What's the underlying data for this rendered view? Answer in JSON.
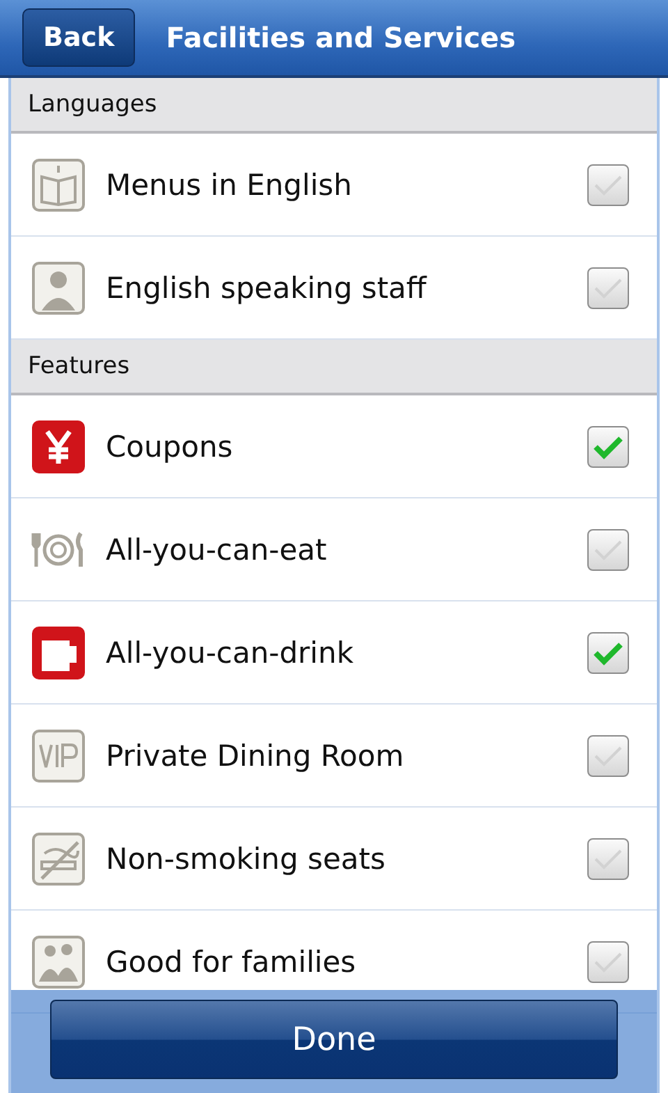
{
  "header": {
    "back_button": "Back",
    "title": "Facilities and Services"
  },
  "sections": [
    {
      "title": "Languages",
      "items": [
        {
          "label": "Menus in English",
          "checked": false
        },
        {
          "label": "English speaking staff",
          "checked": false
        }
      ]
    },
    {
      "title": "Features",
      "items": [
        {
          "label": "Coupons",
          "checked": true
        },
        {
          "label": "All-you-can-eat",
          "checked": false
        },
        {
          "label": "All-you-can-drink",
          "checked": true
        },
        {
          "label": "Private Dining Room",
          "checked": false
        },
        {
          "label": "Non-smoking seats",
          "checked": false
        },
        {
          "label": "Good for families",
          "checked": false
        }
      ]
    }
  ],
  "done_button": "Done"
}
